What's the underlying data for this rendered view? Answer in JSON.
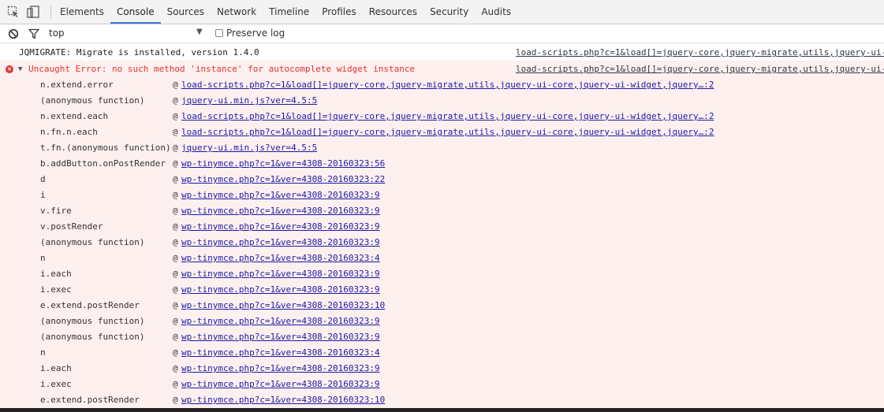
{
  "tabs": [
    {
      "label": "Elements"
    },
    {
      "label": "Console"
    },
    {
      "label": "Sources"
    },
    {
      "label": "Network"
    },
    {
      "label": "Timeline"
    },
    {
      "label": "Profiles"
    },
    {
      "label": "Resources"
    },
    {
      "label": "Security"
    },
    {
      "label": "Audits"
    }
  ],
  "active_tab": "Console",
  "filter": {
    "context": "top",
    "preserve_log_label": "Preserve log",
    "preserve_log_checked": false
  },
  "messages": {
    "log": {
      "text": "JQMIGRATE: Migrate is installed, version 1.4.0",
      "source": "load-scripts.php?c=1&load[]=jquery-core,jquery-migrate,utils,jquery-ui-"
    },
    "error": {
      "text": "Uncaught Error: no such method 'instance' for autocomplete widget instance",
      "source": "load-scripts.php?c=1&load[]=jquery-core,jquery-migrate,utils,jquery-ui-"
    }
  },
  "stack": [
    {
      "fn": "n.extend.error",
      "loc": "load-scripts.php?c=1&load[]=jquery-core,jquery-migrate,utils,jquery-ui-core,jquery-ui-widget,jquery…:2"
    },
    {
      "fn": "(anonymous function)",
      "loc": "jquery-ui.min.js?ver=4.5:5"
    },
    {
      "fn": "n.extend.each",
      "loc": "load-scripts.php?c=1&load[]=jquery-core,jquery-migrate,utils,jquery-ui-core,jquery-ui-widget,jquery…:2"
    },
    {
      "fn": "n.fn.n.each",
      "loc": "load-scripts.php?c=1&load[]=jquery-core,jquery-migrate,utils,jquery-ui-core,jquery-ui-widget,jquery…:2"
    },
    {
      "fn": "t.fn.(anonymous function)",
      "loc": "jquery-ui.min.js?ver=4.5:5"
    },
    {
      "fn": "b.addButton.onPostRender",
      "loc": "wp-tinymce.php?c=1&ver=4308-20160323:56"
    },
    {
      "fn": "d",
      "loc": "wp-tinymce.php?c=1&ver=4308-20160323:22"
    },
    {
      "fn": "i",
      "loc": "wp-tinymce.php?c=1&ver=4308-20160323:9"
    },
    {
      "fn": "v.fire",
      "loc": "wp-tinymce.php?c=1&ver=4308-20160323:9"
    },
    {
      "fn": "v.postRender",
      "loc": "wp-tinymce.php?c=1&ver=4308-20160323:9"
    },
    {
      "fn": "(anonymous function)",
      "loc": "wp-tinymce.php?c=1&ver=4308-20160323:9"
    },
    {
      "fn": "n",
      "loc": "wp-tinymce.php?c=1&ver=4308-20160323:4"
    },
    {
      "fn": "i.each",
      "loc": "wp-tinymce.php?c=1&ver=4308-20160323:9"
    },
    {
      "fn": "i.exec",
      "loc": "wp-tinymce.php?c=1&ver=4308-20160323:9"
    },
    {
      "fn": "e.extend.postRender",
      "loc": "wp-tinymce.php?c=1&ver=4308-20160323:10"
    },
    {
      "fn": "(anonymous function)",
      "loc": "wp-tinymce.php?c=1&ver=4308-20160323:9"
    },
    {
      "fn": "(anonymous function)",
      "loc": "wp-tinymce.php?c=1&ver=4308-20160323:9"
    },
    {
      "fn": "n",
      "loc": "wp-tinymce.php?c=1&ver=4308-20160323:4"
    },
    {
      "fn": "i.each",
      "loc": "wp-tinymce.php?c=1&ver=4308-20160323:9"
    },
    {
      "fn": "i.exec",
      "loc": "wp-tinymce.php?c=1&ver=4308-20160323:9"
    },
    {
      "fn": "e.extend.postRender",
      "loc": "wp-tinymce.php?c=1&ver=4308-20160323:10"
    }
  ],
  "colors": {
    "error_text": "#e0332e",
    "error_bg": "#fff0f0",
    "active_tab_underline": "#3879d9",
    "link": "#1a1aa6"
  },
  "icons": {
    "inspect": "inspect-element-icon",
    "device": "device-mode-icon",
    "clear": "clear-console-icon",
    "filter": "filter-icon",
    "error": "error-icon",
    "expand": "expand-triangle-icon",
    "dropdown": "dropdown-arrow-icon"
  }
}
